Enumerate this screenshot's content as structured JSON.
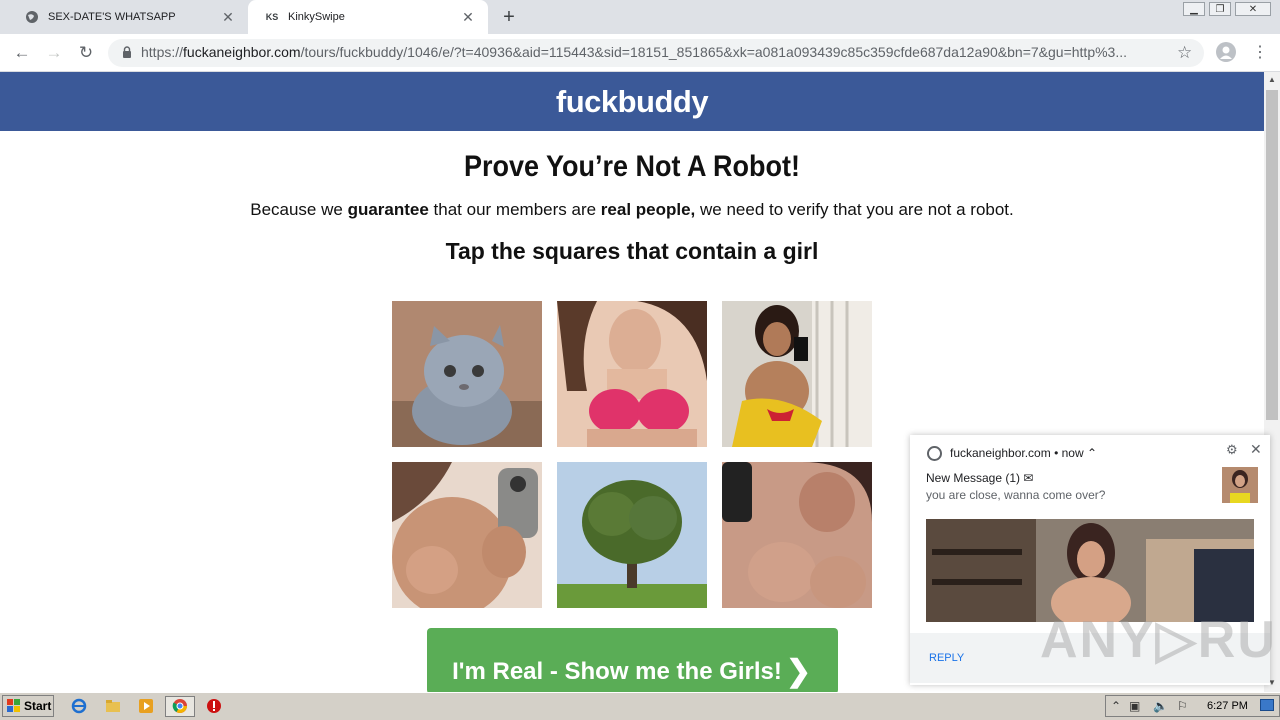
{
  "browser": {
    "tabs": [
      {
        "title": "SEX-DATE'S WHATSAPP"
      },
      {
        "title": "KinkySwipe",
        "favicon_text": "KS"
      }
    ],
    "url_prefix": "https://",
    "url_host": "fuckaneighbor.com",
    "url_path": "/tours/fuckbuddy/1046/e/?t=40936&aid=115443&sid=18151_851865&xk=a081a093439c85c359cfde687da12a90&bn=7&gu=http%3..."
  },
  "page": {
    "brand": "fuckbuddy",
    "brand_color": "#3b5998",
    "headline": "Prove You’re Not A Robot!",
    "subline": {
      "pre": "Because we ",
      "bold1": "guarantee",
      "mid": " that our members are ",
      "bold2": "real people,",
      "post": " we need to verify that you are not a robot."
    },
    "instruction": "Tap the squares that contain a girl",
    "tiles": [
      "kitten",
      "woman",
      "woman",
      "woman",
      "tree",
      "woman"
    ],
    "cta_label": "I'm Real - Show me the Girls!",
    "cta_arrow": "❯",
    "cta_color": "#5aad56"
  },
  "notification": {
    "origin": "fuckaneighbor.com • now ⌃",
    "title": "New Message (1) ✉",
    "body": "you are close, wanna come over?",
    "reply": "REPLY"
  },
  "watermark": "ANY▷RUN",
  "taskbar": {
    "start_label": "Start",
    "clock": "6:27 PM"
  }
}
